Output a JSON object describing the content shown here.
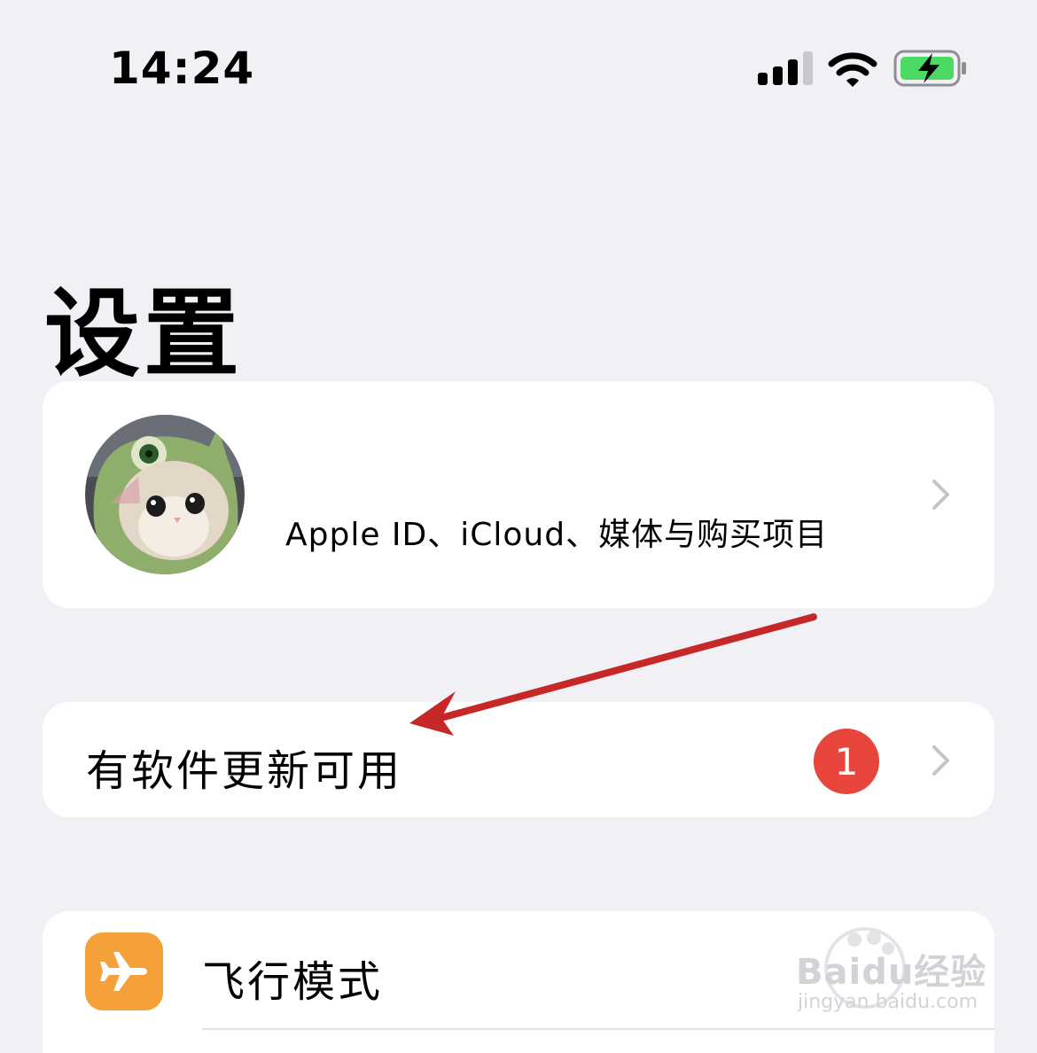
{
  "status_bar": {
    "time": "14:24",
    "icons": [
      "cellular-signal-icon",
      "wifi-icon",
      "battery-charging-icon"
    ],
    "battery_color": "#4cd964"
  },
  "page": {
    "title": "设置"
  },
  "profile": {
    "avatar": "cat-avatar",
    "subtitle": "Apple ID、iCloud、媒体与购买项目"
  },
  "update": {
    "label": "有软件更新可用",
    "badge": "1",
    "badge_color": "#e8453c"
  },
  "settings": {
    "items": [
      {
        "icon": "airplane-icon",
        "icon_bg": "#f4a13a",
        "label": "飞行模式"
      }
    ]
  },
  "annotation": {
    "arrow_color": "#c62828"
  },
  "watermark": {
    "main": "Baidu经验",
    "sub": "jingyan.baidu.com"
  }
}
